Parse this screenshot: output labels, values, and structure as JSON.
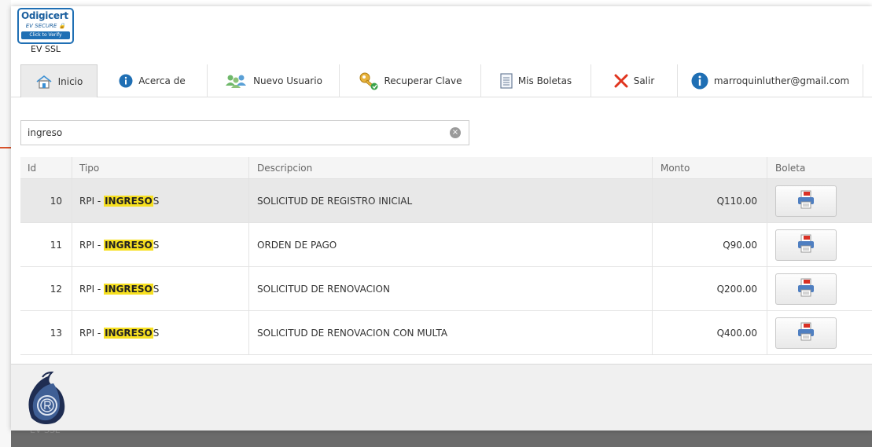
{
  "badge": {
    "brand_prefix": "O",
    "brand": "digicert",
    "ev_text": "EV SECURE 🔒",
    "click_text": "Click to Verify",
    "ev_ssl_label": "EV SSL"
  },
  "nav": {
    "items": [
      {
        "label": "Inicio",
        "icon": "home-icon",
        "active": true
      },
      {
        "label": "Acerca de",
        "icon": "info-icon"
      },
      {
        "label": "Nuevo Usuario",
        "icon": "users-icon"
      },
      {
        "label": "Recuperar Clave",
        "icon": "key-icon"
      },
      {
        "label": "Mis Boletas",
        "icon": "document-icon"
      },
      {
        "label": "Salir",
        "icon": "close-icon"
      },
      {
        "label": "marroquinluther@gmail.com",
        "icon": "info-icon"
      }
    ]
  },
  "search": {
    "value": "ingreso",
    "clear_symbol": "×"
  },
  "table": {
    "headers": {
      "id": "Id",
      "tipo": "Tipo",
      "descripcion": "Descripcion",
      "monto": "Monto",
      "boleta": "Boleta"
    },
    "rows": [
      {
        "id": "10",
        "tipo_prefix": "RPI - ",
        "tipo_highlight": "INGRESO",
        "tipo_suffix": "S",
        "descripcion": "SOLICITUD DE REGISTRO INICIAL",
        "monto": "Q110.00",
        "selected": true
      },
      {
        "id": "11",
        "tipo_prefix": "RPI - ",
        "tipo_highlight": "INGRESO",
        "tipo_suffix": "S",
        "descripcion": "ORDEN DE PAGO",
        "monto": "Q90.00"
      },
      {
        "id": "12",
        "tipo_prefix": "RPI - ",
        "tipo_highlight": "INGRESO",
        "tipo_suffix": "S",
        "descripcion": "SOLICITUD DE RENOVACION",
        "monto": "Q200.00"
      },
      {
        "id": "13",
        "tipo_prefix": "RPI - ",
        "tipo_highlight": "INGRESO",
        "tipo_suffix": "S",
        "descripcion": "SOLICITUD DE RENOVACION CON MULTA",
        "monto": "Q400.00"
      }
    ]
  },
  "background": {
    "bottom_text": "EV SSL"
  },
  "colors": {
    "accent_blue": "#1f6fb4",
    "highlight": "#f7e020",
    "close_red": "#e0341e",
    "red_line": "#d9532c"
  }
}
